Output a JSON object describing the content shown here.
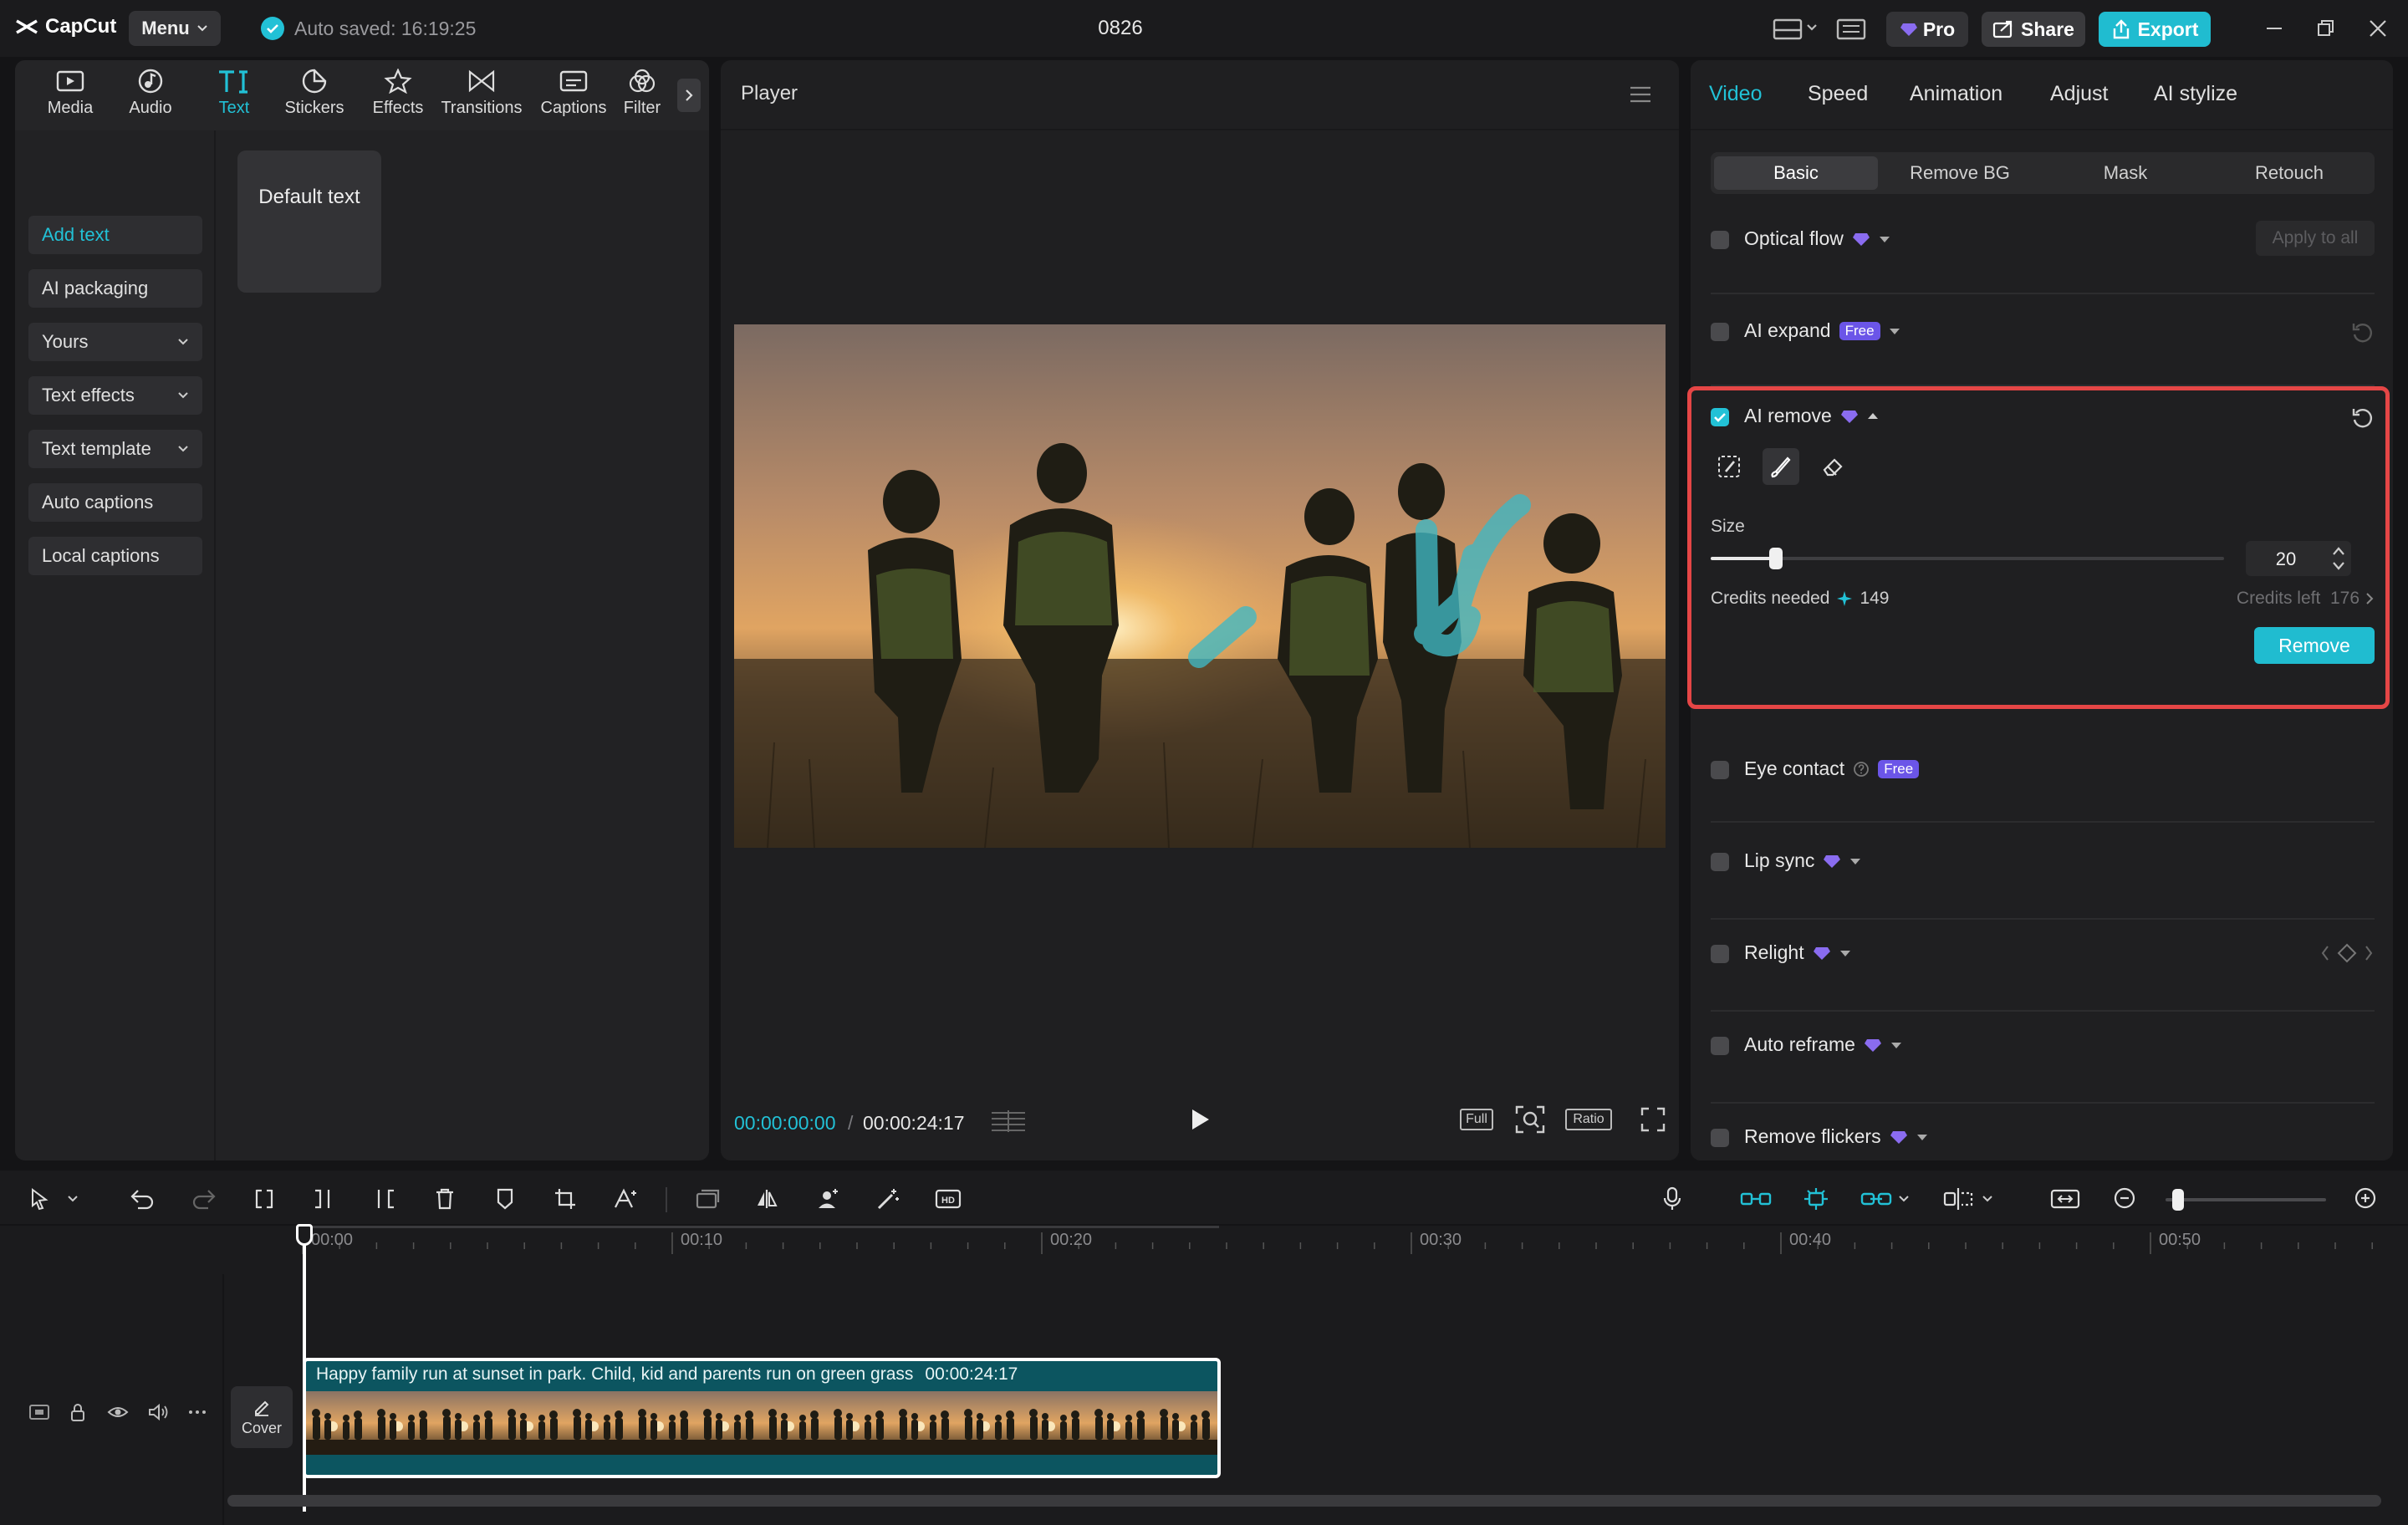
{
  "app": {
    "logo_text": "CapCut",
    "menu_label": "Menu",
    "autosave_text": "Auto saved: 16:19:25",
    "project_title": "0826",
    "pro_label": "Pro",
    "share_label": "Share",
    "export_label": "Export"
  },
  "left": {
    "categories": [
      {
        "label": "Media",
        "icon": "media-icon"
      },
      {
        "label": "Audio",
        "icon": "audio-icon"
      },
      {
        "label": "Text",
        "icon": "text-icon"
      },
      {
        "label": "Stickers",
        "icon": "stickers-icon"
      },
      {
        "label": "Effects",
        "icon": "effects-icon"
      },
      {
        "label": "Transitions",
        "icon": "transitions-icon"
      },
      {
        "label": "Captions",
        "icon": "captions-icon"
      },
      {
        "label": "Filter",
        "icon": "filter-icon"
      }
    ],
    "active_category": "Text",
    "nav": [
      {
        "label": "Add text",
        "dropdown": false
      },
      {
        "label": "AI packaging",
        "dropdown": false
      },
      {
        "label": "Yours",
        "dropdown": true
      },
      {
        "label": "Text effects",
        "dropdown": true
      },
      {
        "label": "Text template",
        "dropdown": true
      },
      {
        "label": "Auto captions",
        "dropdown": false
      },
      {
        "label": "Local captions",
        "dropdown": false
      }
    ],
    "default_text_card": "Default text"
  },
  "player": {
    "title": "Player",
    "current_time": "00:00:00:00",
    "separator": "/",
    "total_time": "00:00:24:17",
    "full_label": "Full",
    "ratio_label": "Ratio"
  },
  "right": {
    "tabs": [
      "Video",
      "Speed",
      "Animation",
      "Adjust",
      "AI stylize"
    ],
    "active_tab": "Video",
    "sub_tabs": [
      "Basic",
      "Remove BG",
      "Mask",
      "Retouch"
    ],
    "active_sub_tab": "Basic",
    "options": {
      "optical_flow": {
        "label": "Optical flow",
        "checked": false,
        "apply_all": "Apply to all"
      },
      "ai_expand": {
        "label": "AI expand",
        "badge": "Free",
        "checked": false
      },
      "ai_remove": {
        "label": "AI remove",
        "checked": true
      },
      "eye_contact": {
        "label": "Eye contact",
        "badge": "Free",
        "checked": false
      },
      "lip_sync": {
        "label": "Lip sync",
        "checked": false
      },
      "relight": {
        "label": "Relight",
        "checked": false
      },
      "auto_reframe": {
        "label": "Auto reframe",
        "checked": false
      },
      "remove_flickers": {
        "label": "Remove flickers",
        "checked": false
      }
    },
    "ai_remove_panel": {
      "size_label": "Size",
      "size_value": "20",
      "size_fraction": 0.2,
      "credits_needed_label": "Credits needed",
      "credits_needed_value": "149",
      "credits_left": "Credits left  176",
      "remove_label": "Remove"
    }
  },
  "timeline": {
    "ticks": [
      "00:00",
      "00:10",
      "00:20",
      "00:30",
      "00:40",
      "00:50"
    ],
    "clip_title": "Happy family run at sunset in park. Child, kid and parents run on green grass",
    "clip_duration": "00:00:24:17",
    "cover_label": "Cover",
    "zoom_fraction": 0.04
  },
  "colors": {
    "accent": "#22c1d6",
    "highlight": "#e54646",
    "premium": "#8a6cf0"
  }
}
